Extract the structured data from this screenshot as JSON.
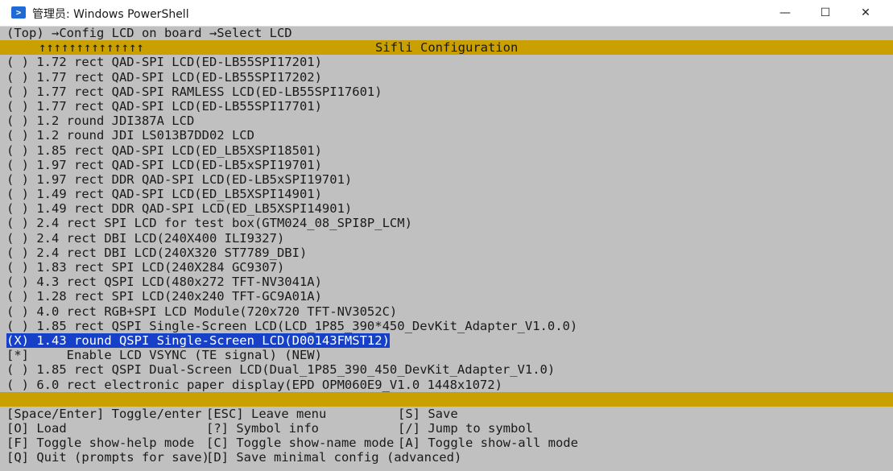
{
  "window": {
    "title": "管理员: Windows PowerShell",
    "app_icon": "powershell-icon",
    "controls": {
      "minimize": "—",
      "maximize": "☐",
      "close": "✕"
    }
  },
  "breadcrumb": "(Top) →Config LCD on board →Select LCD",
  "header": {
    "arrows": "↑↑↑↑↑↑↑↑↑↑↑↑↑↑",
    "title": "Sifli Configuration"
  },
  "items": [
    "( ) 1.72 rect QAD-SPI LCD(ED-LB55SPI17201)",
    "( ) 1.77 rect QAD-SPI LCD(ED-LB55SPI17202)",
    "( ) 1.77 rect QAD-SPI RAMLESS LCD(ED-LB55SPI17601)",
    "( ) 1.77 rect QAD-SPI LCD(ED-LB55SPI17701)",
    "( ) 1.2 round JDI387A LCD",
    "( ) 1.2 round JDI LS013B7DD02 LCD",
    "( ) 1.85 rect QAD-SPI LCD(ED_LB5XSPI18501)",
    "( ) 1.97 rect QAD-SPI LCD(ED-LB5xSPI19701)",
    "( ) 1.97 rect DDR QAD-SPI LCD(ED-LB5xSPI19701)",
    "( ) 1.49 rect QAD-SPI LCD(ED_LB5XSPI14901)",
    "( ) 1.49 rect DDR QAD-SPI LCD(ED_LB5XSPI14901)",
    "( ) 2.4 rect SPI LCD for test box(GTM024_08_SPI8P_LCM)",
    "( ) 2.4 rect DBI LCD(240X400 ILI9327)",
    "( ) 2.4 rect DBI LCD(240X320 ST7789_DBI)",
    "( ) 1.83 rect SPI LCD(240X284 GC9307)",
    "( ) 4.3 rect QSPI LCD(480x272 TFT-NV3041A)",
    "( ) 1.28 rect SPI LCD(240x240 TFT-GC9A01A)",
    "( ) 4.0 rect RGB+SPI LCD Module(720x720 TFT-NV3052C)",
    "( ) 1.85 rect QSPI Single-Screen LCD(LCD_1P85_390*450_DevKit_Adapter_V1.0.0)",
    "(X) 1.43 round QSPI Single-Screen LCD(D00143FMST12)",
    "[*]     Enable LCD VSYNC (TE signal) (NEW)",
    "( ) 1.85 rect QSPI Dual-Screen LCD(Dual_1P85_390_450_DevKit_Adapter_V1.0)",
    "( ) 6.0 rect electronic paper display(EPD OPM060E9_V1.0 1448x1072)"
  ],
  "selected_index": 19,
  "help": [
    [
      "[Space/Enter] Toggle/enter",
      "[ESC] Leave menu",
      "[S] Save"
    ],
    [
      "[O] Load",
      "[?] Symbol info",
      "[/] Jump to symbol"
    ],
    [
      "[F] Toggle show-help mode",
      "[C] Toggle show-name mode",
      "[A] Toggle show-all mode"
    ],
    [
      "[Q] Quit (prompts for save)",
      "[D] Save minimal config (advanced)",
      ""
    ]
  ],
  "colors": {
    "terminal_bg": "#c0c0c0",
    "header_bar": "#c9a000",
    "selection": "#1640c8",
    "text": "#1a1a1a"
  }
}
